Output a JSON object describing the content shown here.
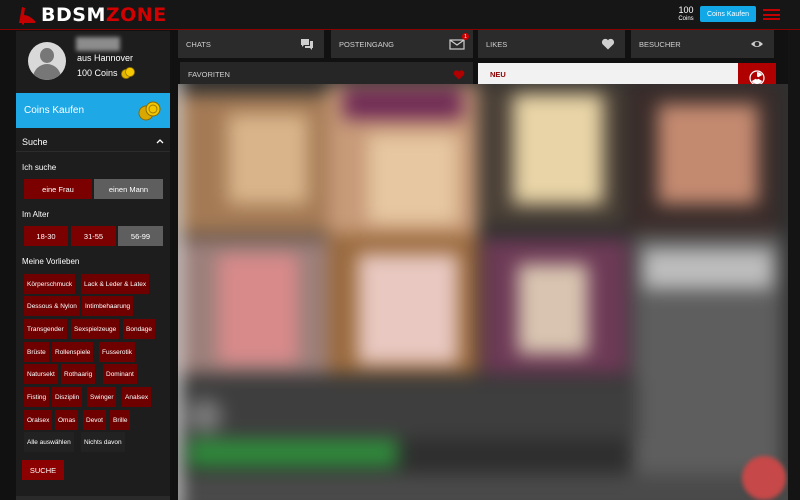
{
  "header": {
    "logo_part1": "BDSM",
    "logo_part2": "ZONE",
    "coins_count": "100",
    "coins_label": "Coins",
    "buy_button": "Coins Kaufen"
  },
  "sidebar": {
    "profile": {
      "location": "aus Hannover",
      "coins": "100 Coins"
    },
    "buy_coins_label": "Coins Kaufen",
    "search": {
      "title": "Suche",
      "seeking_label": "Ich suche",
      "seeking_options": [
        "eine Frau",
        "einen Mann"
      ],
      "age_label": "Im Alter",
      "age_options": [
        "18-30",
        "31-55",
        "56-99"
      ],
      "prefs_label": "Meine Vorlieben",
      "tags": [
        "Körperschmuck",
        "Lack & Leder & Latex",
        "Dessous & Nylon",
        "Intimbehaarung",
        "Transgender",
        "Sexspielzeuge",
        "Bondage",
        "Brüste",
        "Rollenspiele",
        "Fusserotik",
        "Natursekt",
        "Rothaarig",
        "Dominant",
        "Fisting",
        "Disziplin",
        "Swinger",
        "Analsex",
        "Oralsex",
        "Omas",
        "Devot",
        "Brille",
        "Alle auswählen",
        "Nichts davon"
      ],
      "search_button": "SUCHE"
    }
  },
  "nav": {
    "tabs": [
      {
        "label": "CHATS",
        "icon": "chat-icon"
      },
      {
        "label": "POSTEINGANG",
        "icon": "mail-icon",
        "badge": "1"
      },
      {
        "label": "LIKES",
        "icon": "heart-icon"
      },
      {
        "label": "BESUCHER",
        "icon": "eye-icon"
      }
    ]
  },
  "favorites_label": "FAVORITEN",
  "new_label": "NEU",
  "colors": {
    "brand_red": "#d20000",
    "dark_red": "#7b0000",
    "accent_blue": "#1fa8e6"
  }
}
